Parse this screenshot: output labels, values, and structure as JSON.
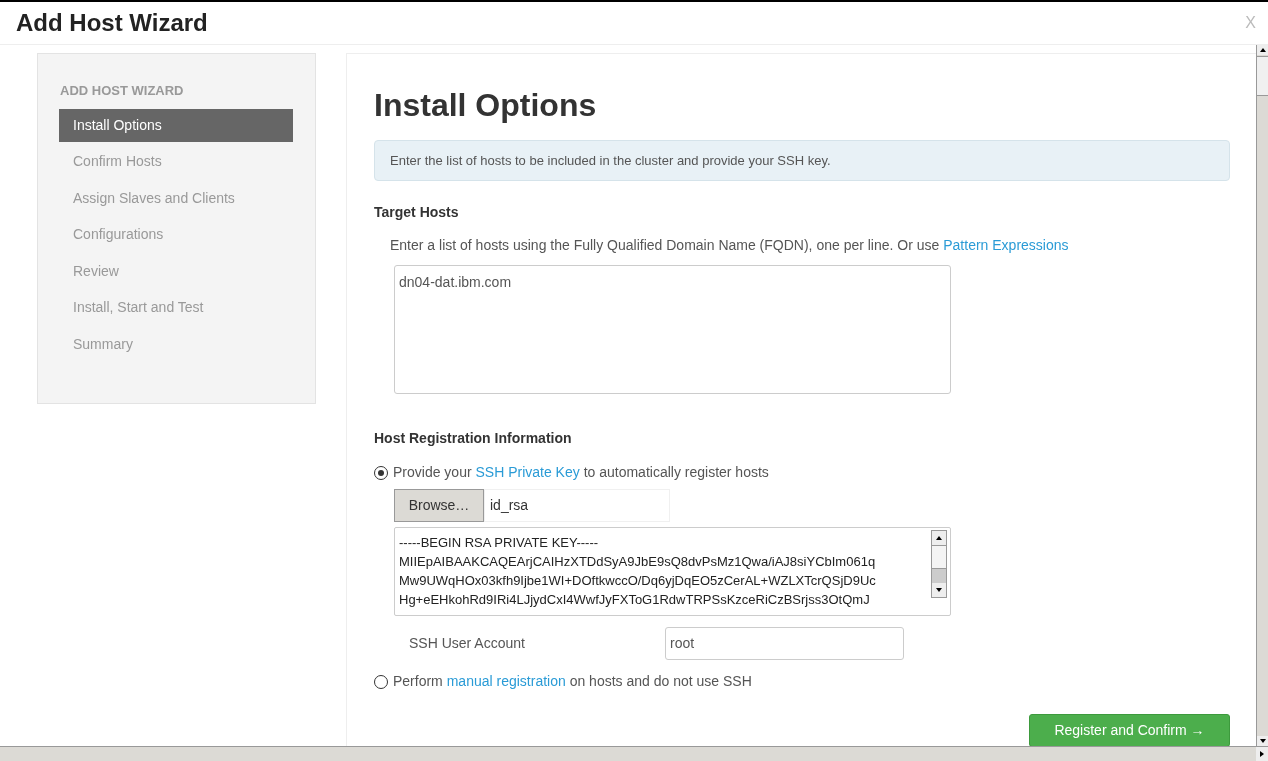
{
  "window": {
    "title": "Add Host Wizard",
    "close": "X"
  },
  "sidebar": {
    "heading": "ADD HOST WIZARD",
    "items": [
      {
        "label": "Install Options",
        "selected": true
      },
      {
        "label": "Confirm Hosts",
        "selected": false
      },
      {
        "label": "Assign Slaves and Clients",
        "selected": false
      },
      {
        "label": "Configurations",
        "selected": false
      },
      {
        "label": "Review",
        "selected": false
      },
      {
        "label": "Install, Start and Test",
        "selected": false
      },
      {
        "label": "Summary",
        "selected": false
      }
    ]
  },
  "main": {
    "title": "Install Options",
    "notice": "Enter the list of hosts to be included in the cluster and provide your SSH key.",
    "target_hosts": {
      "heading": "Target Hosts",
      "instruction": "Enter a list of hosts using the Fully Qualified Domain Name (FQDN), one per line. Or use",
      "link": "Pattern Expressions",
      "value": "dn04-dat.ibm.com"
    },
    "registration": {
      "heading": "Host Registration Information",
      "options": [
        {
          "before": "Provide your",
          "link": "SSH Private Key",
          "after": "to automatically register hosts",
          "selected": true
        },
        {
          "before": "Perform",
          "link": "manual registration",
          "after": "on hosts and do not use SSH",
          "selected": false
        }
      ],
      "browse_button": "Browse…",
      "file_name": "id_rsa",
      "key_lines": [
        "-----BEGIN RSA PRIVATE KEY-----",
        "MIIEpAIBAAKCAQEArjCAIHzXTDdSyA9JbE9sQ8dvPsMz1Qwa/iAJ8siYCbIm061q",
        "Mw9UWqHOx03kfh9Ijbe1WI+DOftkwccO/Dq6yjDqEO5zCerAL+WZLXTcrQSjD9Uc",
        "Hg+eEHkohRd9IRi4LJjydCxI4WwfJyFXToG1RdwTRPSsKzceRiCzBSrjss3OtQmJ"
      ],
      "user_account_label": "SSH User Account",
      "user_account_value": "root"
    },
    "submit_button": "Register and Confirm →"
  }
}
